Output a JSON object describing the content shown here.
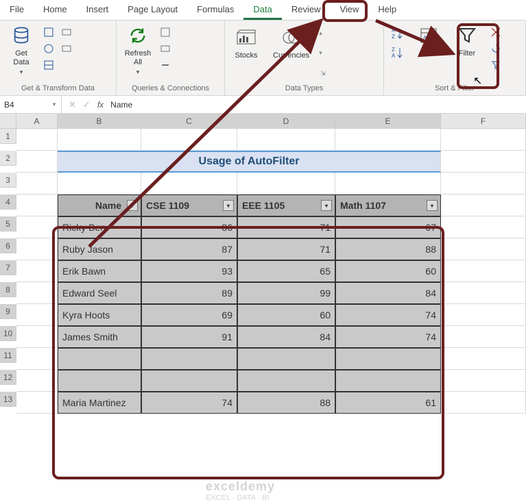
{
  "tabs": {
    "file": "File",
    "home": "Home",
    "insert": "Insert",
    "page_layout": "Page Layout",
    "formulas": "Formulas",
    "data": "Data",
    "review": "Review",
    "view": "View",
    "help": "Help"
  },
  "ribbon": {
    "get_data": "Get\nData",
    "refresh_all": "Refresh\nAll",
    "stocks": "Stocks",
    "currencies": "Currencies",
    "sort": "Sort",
    "filter": "Filter",
    "group_transform": "Get & Transform Data",
    "group_queries": "Queries & Connections",
    "group_types": "Data Types",
    "group_sort": "Sort & Filter"
  },
  "namebox": "B4",
  "fx": "Name",
  "columns": [
    "A",
    "B",
    "C",
    "D",
    "E",
    "F"
  ],
  "rows": [
    "1",
    "2",
    "3",
    "4",
    "5",
    "6",
    "7",
    "8",
    "9",
    "10",
    "11",
    "12",
    "13"
  ],
  "title": "Usage of AutoFilter",
  "headers": {
    "name": "Name",
    "c1": "CSE 1109",
    "c2": "EEE 1105",
    "c3": "Math 1107"
  },
  "data": [
    {
      "name": "Ricky Ben",
      "c1": "86",
      "c2": "71",
      "c3": "67"
    },
    {
      "name": "Ruby Jason",
      "c1": "87",
      "c2": "71",
      "c3": "88"
    },
    {
      "name": "Erik Bawn",
      "c1": "93",
      "c2": "65",
      "c3": "60"
    },
    {
      "name": "Edward Seel",
      "c1": "89",
      "c2": "99",
      "c3": "84"
    },
    {
      "name": "Kyra Hoots",
      "c1": "69",
      "c2": "60",
      "c3": "74"
    },
    {
      "name": "James Smith",
      "c1": "91",
      "c2": "84",
      "c3": "74"
    },
    {
      "name": "",
      "c1": "",
      "c2": "",
      "c3": ""
    },
    {
      "name": "",
      "c1": "",
      "c2": "",
      "c3": ""
    },
    {
      "name": "Maria Martinez",
      "c1": "74",
      "c2": "88",
      "c3": "61"
    }
  ],
  "watermark": {
    "title": "exceldemy",
    "sub": "EXCEL · DATA · BI"
  }
}
